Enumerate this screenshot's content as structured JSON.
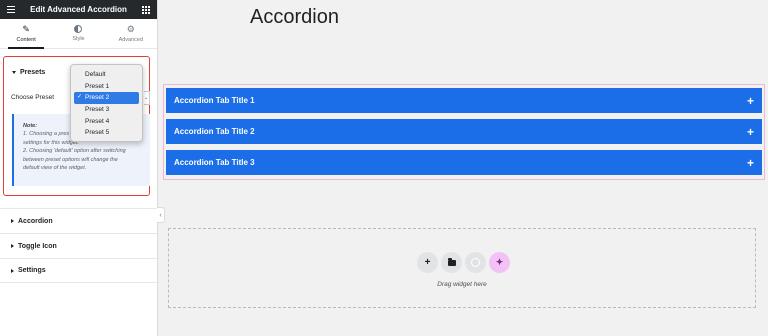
{
  "panel": {
    "title": "Edit Advanced Accordion",
    "tabs": [
      {
        "label": "Content",
        "icon": "pencil-icon",
        "active": true
      },
      {
        "label": "Style",
        "icon": "half-circle-icon",
        "active": false
      },
      {
        "label": "Advanced",
        "icon": "gear-icon",
        "active": false
      }
    ],
    "presets": {
      "section_label": "Presets",
      "choose_label": "Choose Preset",
      "options": [
        "Default",
        "Preset 1",
        "Preset 2",
        "Preset 3",
        "Preset 4",
        "Preset 5"
      ],
      "selected": "Preset 2",
      "note_title": "Note:",
      "note_line1": "1. Choosing a pres",
      "note_line2": "settings for this widget.",
      "note_line3": "2. Choosing 'default' option after switching",
      "note_line4": "between preset options will change the",
      "note_line5": "default view of the widget."
    },
    "sections": [
      "Accordion",
      "Toggle Icon",
      "Settings"
    ]
  },
  "canvas": {
    "page_title": "Accordion",
    "accordion_items": [
      "Accordion Tab Title 1",
      "Accordion Tab Title 2",
      "Accordion Tab Title 3"
    ],
    "expand_symbol": "+",
    "dropzone_text": "Drag widget here"
  },
  "colors": {
    "accent_blue": "#1b6ee8",
    "header_dark": "#26292c",
    "highlight_red": "#e53e30",
    "selected_option": "#2f7ae5"
  }
}
